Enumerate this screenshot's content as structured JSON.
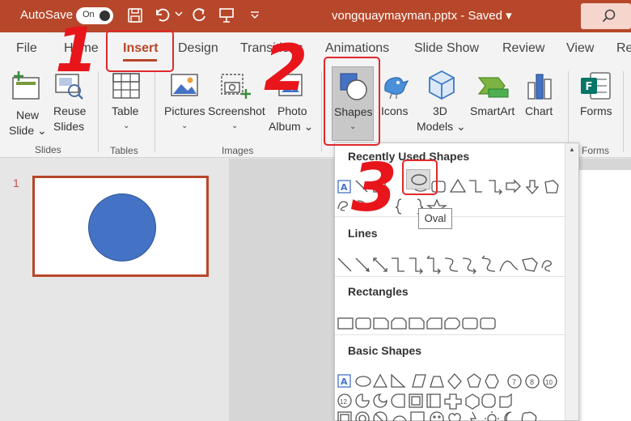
{
  "titlebar": {
    "autosave_label": "AutoSave",
    "toggle_state": "On",
    "document_title": "vongquaymayman.pptx",
    "saved_status": "Saved"
  },
  "tabs": [
    {
      "label": "File"
    },
    {
      "label": "Home"
    },
    {
      "label": "Insert",
      "active": true
    },
    {
      "label": "Design"
    },
    {
      "label": "Transitions"
    },
    {
      "label": "Animations"
    },
    {
      "label": "Slide Show"
    },
    {
      "label": "Review"
    },
    {
      "label": "View"
    },
    {
      "label": "Re"
    }
  ],
  "ribbon": {
    "new_slide_1": "New",
    "new_slide_2": "Slide",
    "reuse_slides_1": "Reuse",
    "reuse_slides_2": "Slides",
    "table": "Table",
    "pictures": "Pictures",
    "screenshot": "Screenshot",
    "photo_album_1": "Photo",
    "photo_album_2": "Album",
    "shapes": "Shapes",
    "icons": "Icons",
    "models_1": "3D",
    "models_2": "Models",
    "smartart": "SmartArt",
    "chart": "Chart",
    "forms": "Forms",
    "groups": {
      "slides": "Slides",
      "tables": "Tables",
      "images": "Images",
      "forms": "Forms"
    }
  },
  "thumbnails": {
    "slide_number": "1"
  },
  "shapes_gallery": {
    "sections": [
      {
        "title": "Recently Used Shapes"
      },
      {
        "title": "Lines"
      },
      {
        "title": "Rectangles"
      },
      {
        "title": "Basic Shapes"
      }
    ],
    "tooltip": "Oval"
  },
  "annotations": {
    "step1": "1",
    "step2": "2",
    "step3": "3"
  },
  "colors": {
    "accent": "#b7472a",
    "annotation_red": "#e8151b",
    "shape_blue": "#4472c4"
  }
}
